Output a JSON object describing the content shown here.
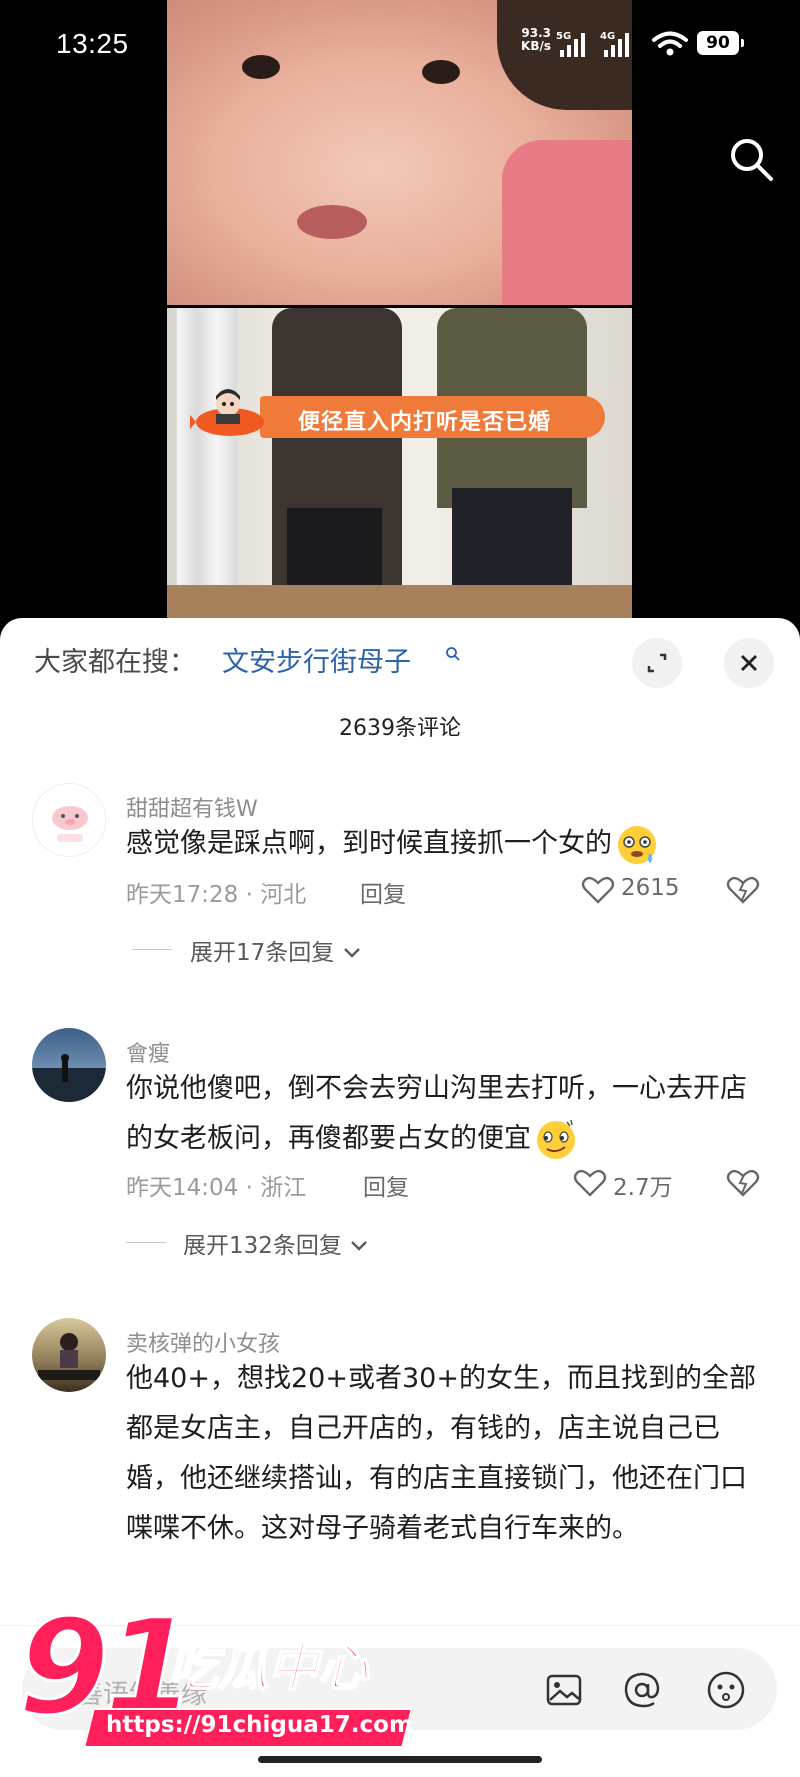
{
  "status_bar": {
    "time": "13:25",
    "net_speed_value": "93.3",
    "net_speed_unit": "KB/s",
    "net_5g": "5G",
    "net_4g": "4G",
    "battery": "90"
  },
  "video": {
    "caption": "便径直入内打听是否已婚"
  },
  "sheet": {
    "search_prefix": "大家都在搜：",
    "search_term": "文安步行街母子",
    "comment_count": "2639条评论"
  },
  "comments": [
    {
      "username": "甜甜超有钱W",
      "text": "感觉像是踩点啊，到时候直接抓一个女的",
      "time": "昨天17:28",
      "location": "河北",
      "reply_label": "回复",
      "likes": "2615",
      "expand_label": "展开17条回复"
    },
    {
      "username": "會瘦",
      "text": "你说他傻吧，倒不会去穷山沟里去打听，一心去开店的女老板问，再傻都要占女的便宜",
      "time": "昨天14:04",
      "location": "浙江",
      "reply_label": "回复",
      "likes": "2.7万",
      "expand_label": "展开132条回复"
    },
    {
      "username": "卖核弹的小女孩",
      "text": "他40+，想找20+或者30+的女生，而且找到的全部都是女店主，自己开店的，有钱的，店主说自己已婚，他还继续搭讪，有的店主直接锁门，他还在门口喋喋不休。这对母子骑着老式自行车来的。"
    }
  ],
  "input": {
    "placeholder": "善语结善缘"
  },
  "watermark": {
    "number": "91",
    "name": "吃瓜中心",
    "url": "https://91chigua17.com"
  },
  "colors": {
    "link": "#2d63a8",
    "watermark": "#ff1f5a",
    "caption_bar": "#f07a3a"
  }
}
